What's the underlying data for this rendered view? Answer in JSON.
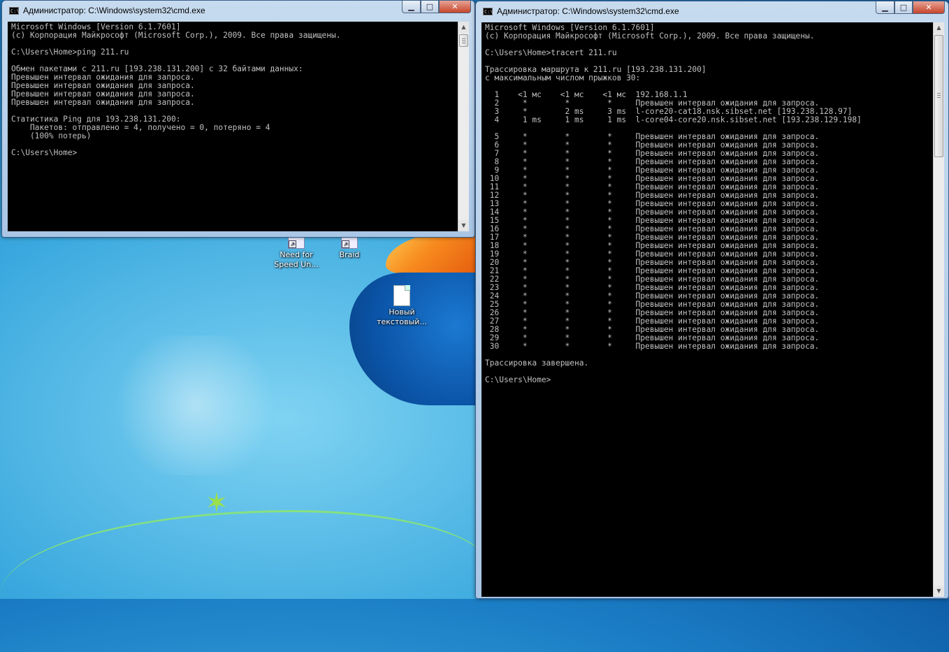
{
  "desktop": {
    "icons": [
      {
        "label_line1": "Need for",
        "label_line2": "Speed Un...",
        "icon": "game-shortcut-icon"
      },
      {
        "label_line1": "Braid",
        "label_line2": "",
        "icon": "game-shortcut-icon"
      },
      {
        "label_line1": "Новый",
        "label_line2": "текстовый...",
        "icon": "text-file-icon"
      }
    ]
  },
  "window_left": {
    "title": "Администратор: C:\\Windows\\system32\\cmd.exe",
    "console_text": "Microsoft Windows [Version 6.1.7601]\n(c) Корпорация Майкрософт (Microsoft Corp.), 2009. Все права защищены.\n\nC:\\Users\\Home>ping 211.ru\n\nОбмен пакетами с 211.ru [193.238.131.200] с 32 байтами данных:\nПревышен интервал ожидания для запроса.\nПревышен интервал ожидания для запроса.\nПревышен интервал ожидания для запроса.\nПревышен интервал ожидания для запроса.\n\nСтатистика Ping для 193.238.131.200:\n    Пакетов: отправлено = 4, получено = 0, потеряно = 4\n    (100% потерь)\n\nC:\\Users\\Home>"
  },
  "window_right": {
    "title": "Администратор: C:\\Windows\\system32\\cmd.exe",
    "console_text": "Microsoft Windows [Version 6.1.7601]\n(c) Корпорация Майкрософт (Microsoft Corp.), 2009. Все права защищены.\n\nC:\\Users\\Home>tracert 211.ru\n\nТрассировка маршрута к 211.ru [193.238.131.200]\nс максимальным числом прыжков 30:\n\n  1    <1 мс    <1 мс    <1 мс  192.168.1.1\n  2     *        *        *     Превышен интервал ожидания для запроса.\n  3     *        2 ms     3 ms  l-core20-cat18.nsk.sibset.net [193.238.128.97]\n  4     1 ms     1 ms     1 ms  l-core04-core20.nsk.sibset.net [193.238.129.198]\n\n  5     *        *        *     Превышен интервал ожидания для запроса.\n  6     *        *        *     Превышен интервал ожидания для запроса.\n  7     *        *        *     Превышен интервал ожидания для запроса.\n  8     *        *        *     Превышен интервал ожидания для запроса.\n  9     *        *        *     Превышен интервал ожидания для запроса.\n 10     *        *        *     Превышен интервал ожидания для запроса.\n 11     *        *        *     Превышен интервал ожидания для запроса.\n 12     *        *        *     Превышен интервал ожидания для запроса.\n 13     *        *        *     Превышен интервал ожидания для запроса.\n 14     *        *        *     Превышен интервал ожидания для запроса.\n 15     *        *        *     Превышен интервал ожидания для запроса.\n 16     *        *        *     Превышен интервал ожидания для запроса.\n 17     *        *        *     Превышен интервал ожидания для запроса.\n 18     *        *        *     Превышен интервал ожидания для запроса.\n 19     *        *        *     Превышен интервал ожидания для запроса.\n 20     *        *        *     Превышен интервал ожидания для запроса.\n 21     *        *        *     Превышен интервал ожидания для запроса.\n 22     *        *        *     Превышен интервал ожидания для запроса.\n 23     *        *        *     Превышен интервал ожидания для запроса.\n 24     *        *        *     Превышен интервал ожидания для запроса.\n 25     *        *        *     Превышен интервал ожидания для запроса.\n 26     *        *        *     Превышен интервал ожидания для запроса.\n 27     *        *        *     Превышен интервал ожидания для запроса.\n 28     *        *        *     Превышен интервал ожидания для запроса.\n 29     *        *        *     Превышен интервал ожидания для запроса.\n 30     *        *        *     Превышен интервал ожидания для запроса.\n\nТрассировка завершена.\n\nC:\\Users\\Home>"
  },
  "controls": {
    "minimize": "▁",
    "maximize": "□",
    "close": "✕"
  },
  "colors": {
    "console_bg": "#000000",
    "console_text": "#c0c0c0",
    "titlebar": "#a9c6e6"
  }
}
